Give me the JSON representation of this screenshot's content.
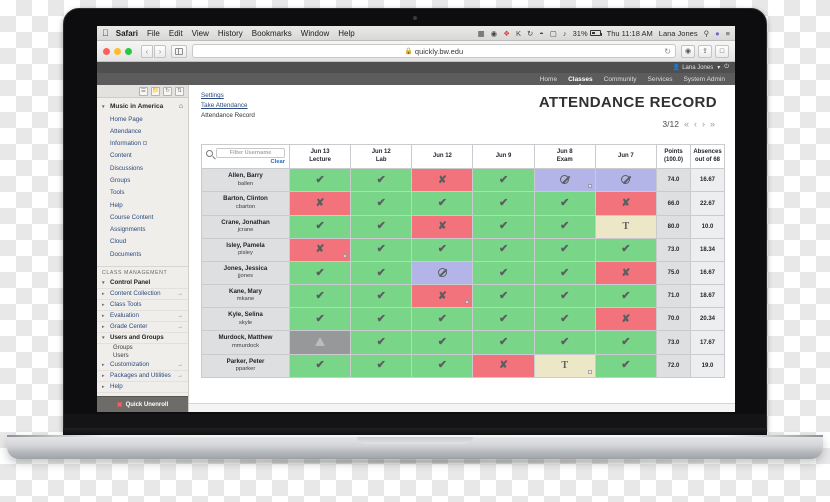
{
  "menubar": {
    "apple": "apple-logo",
    "items": [
      "Safari",
      "File",
      "Edit",
      "View",
      "History",
      "Bookmarks",
      "Window",
      "Help"
    ],
    "battery_percent": "31%",
    "clock": "Thu 11:18 AM",
    "user": "Lana Jones"
  },
  "browser": {
    "url": "quickly.bw.edu",
    "lock": "lock-icon",
    "reload": "reload-icon"
  },
  "site": {
    "user": "Lana Jones",
    "nav": [
      {
        "label": "Home",
        "active": false
      },
      {
        "label": "Classes",
        "active": true
      },
      {
        "label": "Community",
        "active": false
      },
      {
        "label": "Services",
        "active": false
      },
      {
        "label": "System Admin",
        "active": false
      }
    ]
  },
  "sidebar": {
    "course": "Music in America",
    "links": [
      "Home Page",
      "Attendance",
      "Information",
      "Content",
      "Discussions",
      "Groups",
      "Tools",
      "Help",
      "Course Content",
      "Assignments",
      "Cloud",
      "Documents"
    ],
    "section_title": "CLASS MANAGEMENT",
    "panel": [
      {
        "label": "Control Panel",
        "bold": true,
        "arrow": false
      },
      {
        "label": "Content Collection",
        "bold": false,
        "arrow": true
      },
      {
        "label": "Class Tools",
        "bold": false,
        "arrow": false
      },
      {
        "label": "Evaluation",
        "bold": false,
        "arrow": true
      },
      {
        "label": "Grade Center",
        "bold": false,
        "arrow": true
      },
      {
        "label": "Users and Groups",
        "bold": true,
        "arrow": false
      }
    ],
    "subitems": [
      "Groups",
      "Users"
    ],
    "panel2": [
      {
        "label": "Customization",
        "bold": false,
        "arrow": true
      },
      {
        "label": "Packages and Utilities",
        "bold": false,
        "arrow": true
      },
      {
        "label": "Help",
        "bold": false,
        "arrow": false
      }
    ],
    "quick_unenroll": "Quick Unenroll"
  },
  "main": {
    "breadcrumbs": [
      {
        "label": "Settings",
        "link": true
      },
      {
        "label": "Take Attendance",
        "link": true
      },
      {
        "label": "Attendance Record",
        "link": false
      }
    ],
    "title": "ATTENDANCE RECORD",
    "pager": {
      "position": "3/12",
      "first": "«",
      "prev": "‹",
      "next": "›",
      "last": "»"
    },
    "filter": {
      "placeholder": "Filter Username",
      "value": "",
      "clear_label": "Clear"
    },
    "columns": [
      {
        "line1": "Jun 13",
        "line2": "Lecture"
      },
      {
        "line1": "Jun 12",
        "line2": "Lab"
      },
      {
        "line1": "Jun 12",
        "line2": ""
      },
      {
        "line1": "Jun 9",
        "line2": ""
      },
      {
        "line1": "Jun 8",
        "line2": "Exam"
      },
      {
        "line1": "Jun 7",
        "line2": ""
      },
      {
        "line1": "Points",
        "line2": "(100.0)"
      },
      {
        "line1": "Absences",
        "line2": "out of 68"
      }
    ],
    "legend_colors": {
      "present": "#79d588",
      "absent": "#f3737c",
      "exempt": "#b3b4e8",
      "tardy": "#ece7c6",
      "none": "#96989a"
    },
    "rows": [
      {
        "name": "Allen, Barry",
        "username": "ballen",
        "marks": [
          "present",
          "present",
          "absent",
          "present",
          "exempt-note",
          "exempt"
        ],
        "points": "74.0",
        "absences": "16.67"
      },
      {
        "name": "Barton, Clinton",
        "username": "cbarton",
        "marks": [
          "absent",
          "present",
          "present",
          "present",
          "present",
          "absent"
        ],
        "points": "66.0",
        "absences": "22.67"
      },
      {
        "name": "Crane, Jonathan",
        "username": "jcrane",
        "marks": [
          "present",
          "present",
          "absent",
          "present",
          "present",
          "tardy"
        ],
        "points": "80.0",
        "absences": "10.0"
      },
      {
        "name": "Isley, Pamela",
        "username": "pisley",
        "marks": [
          "absent-note",
          "present",
          "present",
          "present",
          "present",
          "present"
        ],
        "points": "73.0",
        "absences": "18.34"
      },
      {
        "name": "Jones, Jessica",
        "username": "jjones",
        "marks": [
          "present",
          "present",
          "exempt",
          "present",
          "present",
          "absent"
        ],
        "points": "75.0",
        "absences": "16.67"
      },
      {
        "name": "Kane, Mary",
        "username": "mkane",
        "marks": [
          "present",
          "present",
          "absent-note",
          "present",
          "present",
          "present"
        ],
        "points": "71.0",
        "absences": "18.67"
      },
      {
        "name": "Kyle, Selina",
        "username": "skyle",
        "marks": [
          "present",
          "present",
          "present",
          "present",
          "present",
          "absent"
        ],
        "points": "70.0",
        "absences": "20.34"
      },
      {
        "name": "Murdock, Matthew",
        "username": "mmurdock",
        "marks": [
          "none",
          "present",
          "present",
          "present",
          "present",
          "present"
        ],
        "points": "73.0",
        "absences": "17.67"
      },
      {
        "name": "Parker, Peter",
        "username": "pparker",
        "marks": [
          "present",
          "present",
          "present",
          "absent",
          "tardy-note",
          "present"
        ],
        "points": "72.0",
        "absences": "19.0"
      }
    ]
  }
}
